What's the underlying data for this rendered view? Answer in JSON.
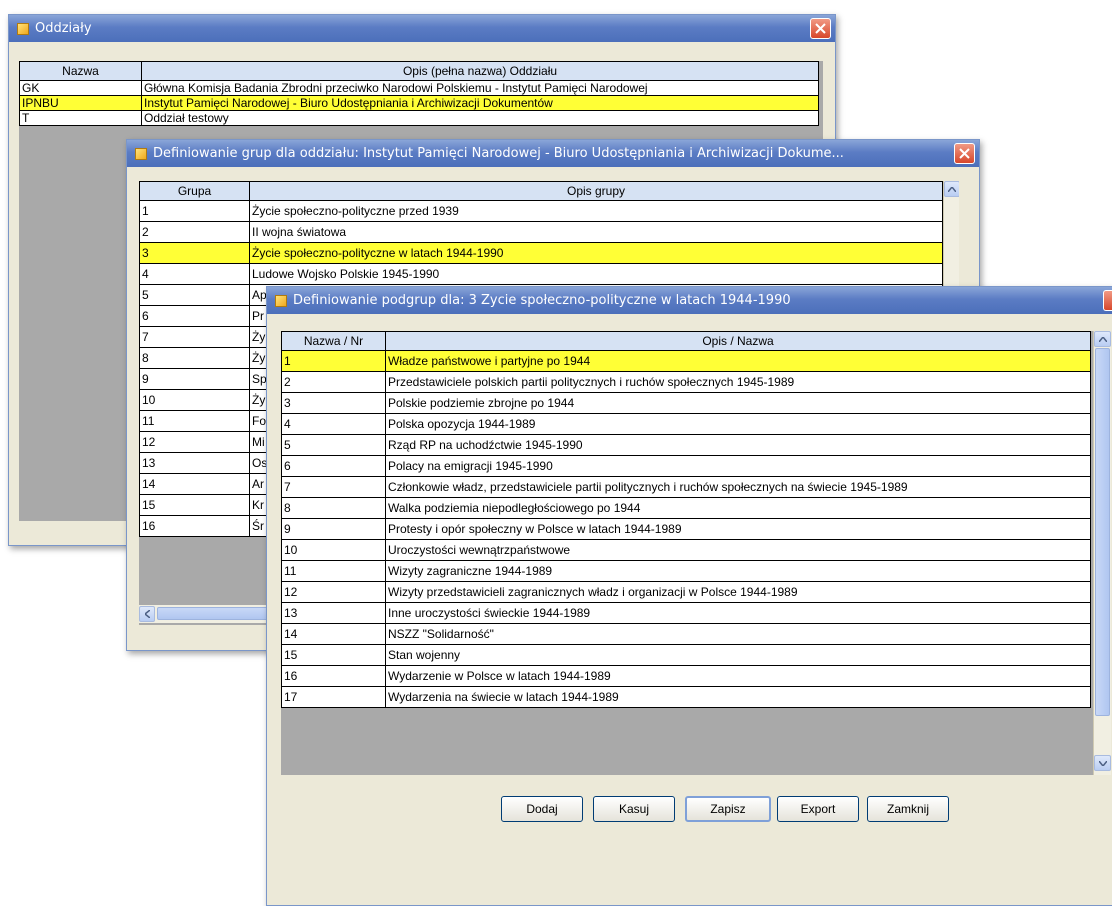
{
  "win1": {
    "title": "Oddziały",
    "columns": [
      "Nazwa",
      "Opis (pełna nazwa) Oddziału"
    ],
    "rows": [
      [
        "GK",
        "Główna Komisja Badania Zbrodni przeciwko Narodowi Polskiemu - Instytut Pamięci Narodowej"
      ],
      [
        "IPNBU",
        "Instytut Pamięci Narodowej - Biuro Udostępniania i Archiwizacji Dokumentów"
      ],
      [
        "T",
        "Oddział testowy"
      ]
    ],
    "selected_index": 1
  },
  "win2": {
    "title": "Definiowanie grup dla oddziału: Instytut Pamięci Narodowej - Biuro Udostępniania i Archiwizacji Dokume...",
    "columns": [
      "Grupa",
      "Opis grupy"
    ],
    "rows": [
      [
        "1",
        "Życie społeczno-polityczne przed 1939"
      ],
      [
        "2",
        "II wojna światowa"
      ],
      [
        "3",
        "Życie społeczno-polityczne w latach 1944-1990"
      ],
      [
        "4",
        "Ludowe Wojsko Polskie 1945-1990"
      ],
      [
        "5",
        "Ap"
      ],
      [
        "6",
        "Pr"
      ],
      [
        "7",
        "Ży"
      ],
      [
        "8",
        "Ży"
      ],
      [
        "9",
        "Sp"
      ],
      [
        "10",
        "Ży"
      ],
      [
        "11",
        "Fo"
      ],
      [
        "12",
        "Mi"
      ],
      [
        "13",
        "Os"
      ],
      [
        "14",
        "Ar"
      ],
      [
        "15",
        "Kr"
      ],
      [
        "16",
        "Śr"
      ]
    ],
    "selected_index": 2
  },
  "win3": {
    "title": "Definiowanie podgrup dla: 3 Życie społeczno-polityczne w latach 1944-1990",
    "columns": [
      "Nazwa / Nr",
      "Opis / Nazwa"
    ],
    "rows": [
      [
        "1",
        "Władze państwowe i partyjne po 1944"
      ],
      [
        "2",
        "Przedstawiciele polskich partii politycznych i ruchów społecznych 1945-1989"
      ],
      [
        "3",
        "Polskie podziemie zbrojne po 1944"
      ],
      [
        "4",
        "Polska opozycja 1944-1989"
      ],
      [
        "5",
        "Rząd RP na uchodźctwie 1945-1990"
      ],
      [
        "6",
        "Polacy na emigracji 1945-1990"
      ],
      [
        "7",
        "Członkowie władz, przedstawiciele partii politycznych i ruchów społecznych na świecie 1945-1989"
      ],
      [
        "8",
        "Walka podziemia niepodległościowego po 1944"
      ],
      [
        "9",
        "Protesty i opór społeczny w Polsce w latach 1944-1989"
      ],
      [
        "10",
        "Uroczystości wewnątrzpaństwowe"
      ],
      [
        "11",
        "Wizyty zagraniczne 1944-1989"
      ],
      [
        "12",
        "Wizyty przedstawicieli zagranicznych władz i organizacji w Polsce 1944-1989"
      ],
      [
        "13",
        "Inne uroczystości świeckie 1944-1989"
      ],
      [
        "14",
        "NSZZ \"Solidarność\""
      ],
      [
        "15",
        "Stan wojenny"
      ],
      [
        "16",
        "Wydarzenie w Polsce w latach 1944-1989"
      ],
      [
        "17",
        "Wydarzenia na świecie w latach 1944-1989"
      ]
    ],
    "selected_index": 0,
    "buttons": {
      "add": "Dodaj",
      "delete": "Kasuj",
      "save": "Zapisz",
      "export": "Export",
      "close": "Zamknij"
    }
  },
  "colors": {
    "selection": "#ffff36",
    "header": "#d6e2f3",
    "titlebar": "#5b7cc4",
    "close": "#d8472b"
  }
}
